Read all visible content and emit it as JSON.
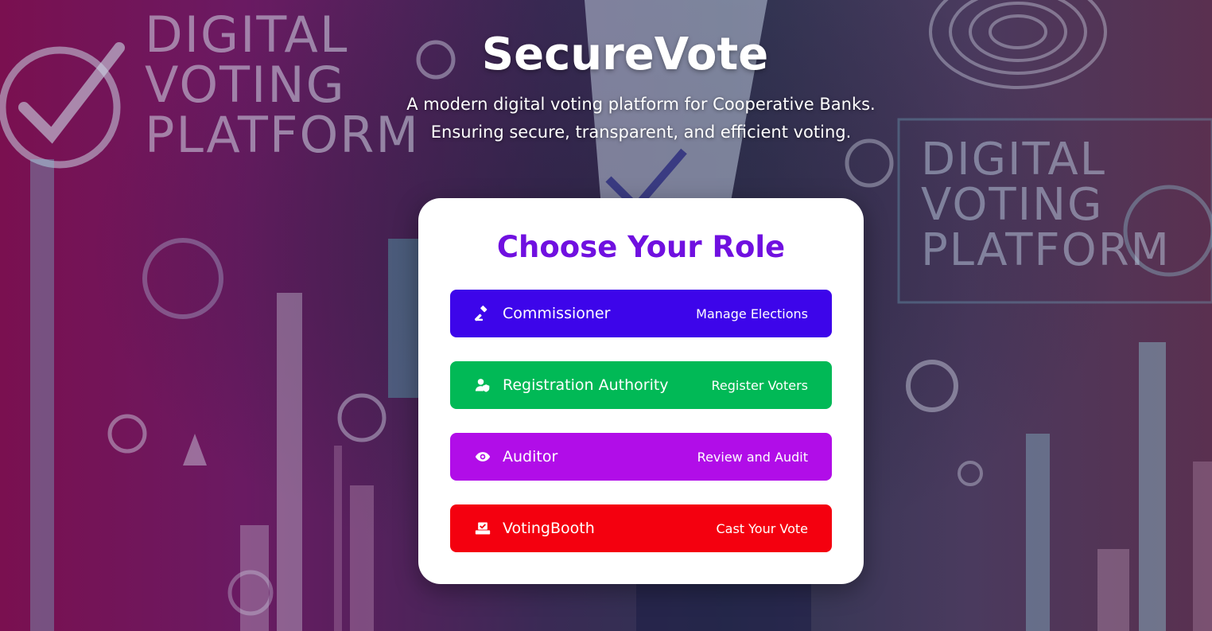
{
  "app": {
    "title": "SecureVote",
    "tagline_line1": "A modern digital voting platform for Cooperative Banks.",
    "tagline_line2": "Ensuring secure, transparent, and efficient voting."
  },
  "background": {
    "left_text": [
      "DIGITAL",
      "VOTING",
      "PLATFORM"
    ],
    "right_text": [
      "DIGITAL",
      "VOTING",
      "PLATFORM"
    ]
  },
  "card": {
    "title": "Choose Your Role"
  },
  "roles": [
    {
      "name": "Commissioner",
      "description": "Manage Elections",
      "icon": "gavel-icon",
      "color": "#3d05ea"
    },
    {
      "name": "Registration Authority",
      "description": "Register Voters",
      "icon": "user-shield-icon",
      "color": "#01b956"
    },
    {
      "name": "Auditor",
      "description": "Review and Audit",
      "icon": "eye-icon",
      "color": "#b10de8"
    },
    {
      "name": "VotingBooth",
      "description": "Cast Your Vote",
      "icon": "vote-box-icon",
      "color": "#f4000f"
    }
  ]
}
